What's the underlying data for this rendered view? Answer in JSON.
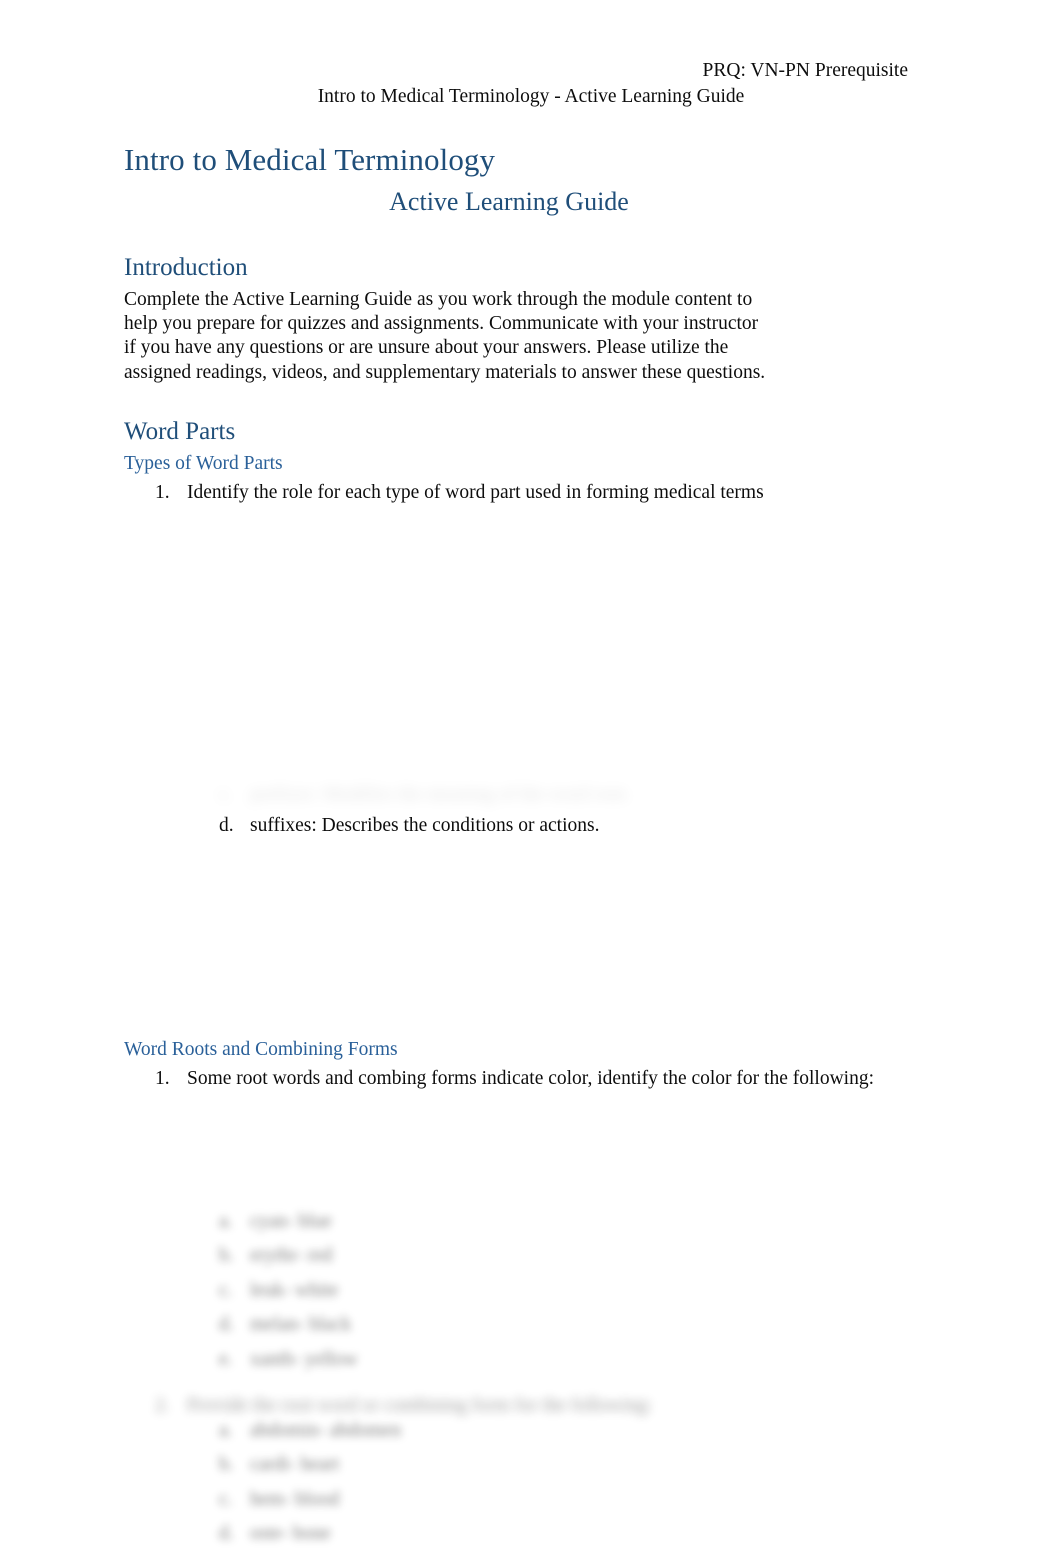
{
  "document": {
    "header": {
      "line1": "PRQ: VN-PN Prerequisite",
      "line2": "Intro to Medical Terminology - Active Learning Guide"
    },
    "title": "Intro to Medical Terminology",
    "subtitle": "Active Learning Guide"
  },
  "introduction": {
    "heading": "Introduction",
    "paragraph": "Complete the Active Learning Guide as you work through the module content to help you prepare for quizzes and assignments. Communicate with your instructor if you have any questions or are unsure about your answers. Please utilize the assigned readings, videos, and supplementary materials to answer these questions."
  },
  "word_parts": {
    "heading": "Word Parts",
    "subheading": "Types of Word Parts",
    "item1": {
      "marker": "1.",
      "text": "Identify the role for each type of word part used in forming medical terms"
    },
    "redacted_band": "",
    "item1_sub_d": {
      "marker": "d.",
      "text": "suffixes: Describes the conditions or actions."
    }
  },
  "word_roots": {
    "heading": "Word Roots and Combining Forms",
    "item1": {
      "marker": "1.",
      "text": "Some root words and combing forms indicate color, identify the color for the following:"
    },
    "item1_subs": [
      {
        "marker": "a.",
        "text": "cyan- blue"
      },
      {
        "marker": "b.",
        "text": "erythr- red"
      },
      {
        "marker": "c.",
        "text": "leuk- white"
      },
      {
        "marker": "d.",
        "text": "melan- black"
      },
      {
        "marker": "e.",
        "text": "xanth- yellow"
      }
    ],
    "item2": {
      "marker": "2.",
      "text": "Provide the root word or combining form for the following:"
    },
    "item2_subs": [
      {
        "marker": "a.",
        "text": "abdomin- abdomen"
      },
      {
        "marker": "b.",
        "text": "cardi- heart"
      },
      {
        "marker": "c.",
        "text": "hem- blood"
      },
      {
        "marker": "d.",
        "text": "oste- bone"
      }
    ]
  },
  "colors": {
    "heading_blue": "#1f4e79",
    "subheading_blue": "#2a6099",
    "body_text": "#0d0d0d",
    "page_background": "#ffffff"
  }
}
